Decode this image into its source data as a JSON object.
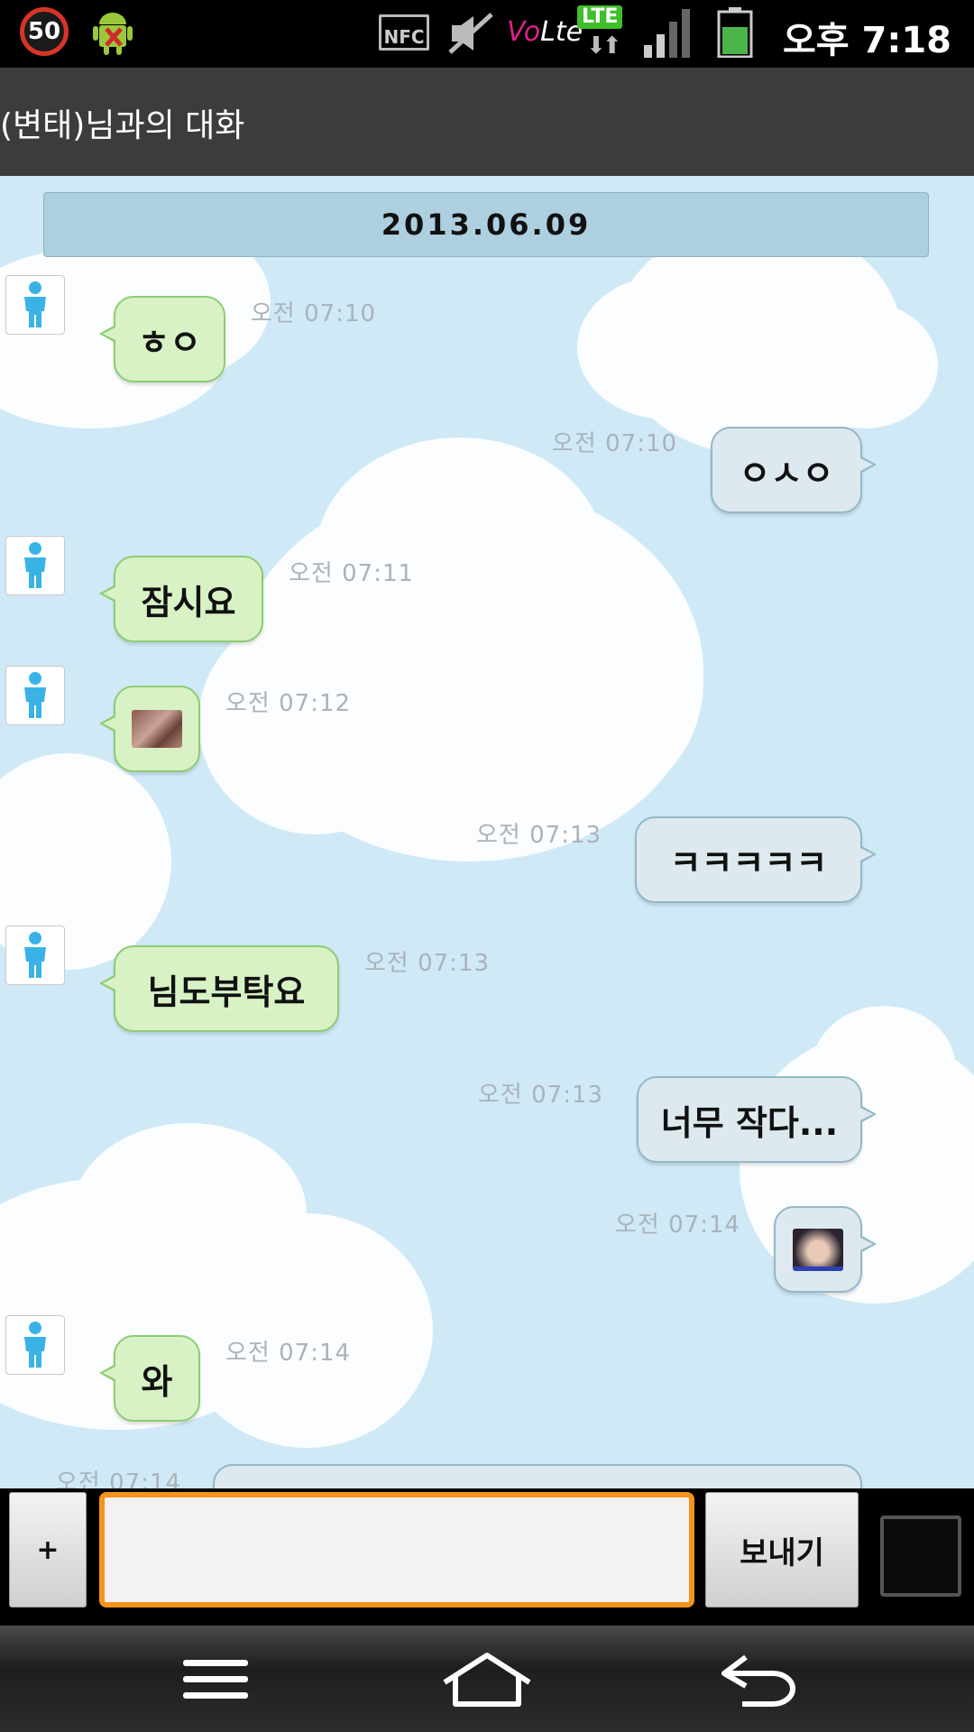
{
  "status_bar": {
    "notification_count": "50",
    "nfc_label": "NFC",
    "volte_prefix": "Vo",
    "volte_suffix": "Lte",
    "lte_label": "LTE",
    "time": "오후 7:18",
    "icons": [
      "android-debug-icon",
      "nfc-icon",
      "mute-icon",
      "volte-icon",
      "lte-icon",
      "signal-icon",
      "battery-icon"
    ]
  },
  "header": {
    "title": "(변태)님과의 대화"
  },
  "chat": {
    "date": "2013.06.09",
    "messages": [
      {
        "side": "received",
        "text": "ㅎㅇ",
        "time": "오전 07:10"
      },
      {
        "side": "sent",
        "text": "ㅇㅅㅇ",
        "time": "오전 07:10"
      },
      {
        "side": "received",
        "text": "잠시요",
        "time": "오전 07:11"
      },
      {
        "side": "received",
        "text": "",
        "image": true,
        "time": "오전 07:12"
      },
      {
        "side": "sent",
        "text": "ㅋㅋㅋㅋㅋ",
        "time": "오전 07:13"
      },
      {
        "side": "received",
        "text": "님도부탁요",
        "time": "오전 07:13"
      },
      {
        "side": "sent",
        "text": "너무 작다...",
        "time": "오전 07:13"
      },
      {
        "side": "sent",
        "text": "",
        "image": true,
        "time": "오전 07:14"
      },
      {
        "side": "received",
        "text": "와",
        "time": "오전 07:14"
      },
      {
        "side": "sent",
        "text": "",
        "time": "오전 07:14",
        "partial": true
      }
    ]
  },
  "input_bar": {
    "plus_label": "+",
    "message_value": "",
    "send_label": "보내기"
  },
  "nav_bar": {
    "icons": [
      "menu-icon",
      "home-icon",
      "back-icon"
    ]
  },
  "colors": {
    "accent": "#f7941d",
    "received_bubble": "#d8f2c6",
    "sent_bubble": "#dde9ef",
    "chat_background": "#cfe9f7"
  }
}
